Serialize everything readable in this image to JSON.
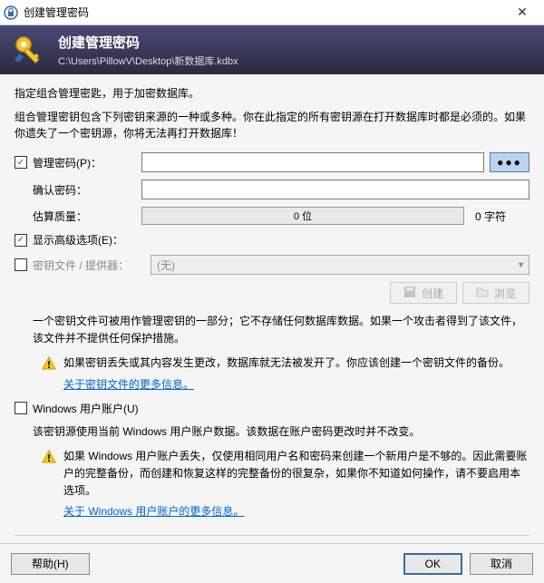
{
  "titlebar": {
    "title": "创建管理密码"
  },
  "header": {
    "title": "创建管理密码",
    "path": "C:\\Users\\PillowV\\Desktop\\新数据库.kdbx"
  },
  "intro": {
    "line1": "指定组合管理密匙，用于加密数据库。",
    "line2": "组合管理密钥包含下列密钥来源的一种或多种。你在此指定的所有密钥源在打开数据库时都是必须的。如果你遗失了一个密钥源，你将无法再打开数据库！"
  },
  "password": {
    "label": "管理密码(P)：",
    "confirm_label": "确认密码：",
    "quality_label": "估算质量：",
    "quality_value": "0 位",
    "char_count": "0 字符",
    "dots": "●●●"
  },
  "advanced": {
    "label": "显示高级选项(E)："
  },
  "keyfile": {
    "label": "密钥文件 / 提供器：",
    "combo_value": "(无)",
    "create_btn": "创建",
    "browse_btn": "浏览",
    "desc": "一个密钥文件可被用作管理密钥的一部分；它不存储任何数据库数据。如果一个攻击者得到了该文件，该文件并不提供任何保护措施。",
    "warn": "如果密钥丢失或其内容发生更改，数据库就无法被发开了。你应该创建一个密钥文件的备份。",
    "link": "关于密钥文件的更多信息。"
  },
  "winuser": {
    "label": "Windows 用户账户(U)",
    "desc": "该密钥源使用当前 Windows 用户账户数据。该数据在账户密码更改时并不改变。",
    "warn": "如果 Windows 用户账户丢失，仅使用相同用户名和密码来创建一个新用户是不够的。因此需要账户的完整备份，而创建和恢复这样的完整备份的很复杂，如果你不知道如何操作，请不要启用本选项。",
    "link": "关于 Windows 用户账户的更多信息。"
  },
  "footer": {
    "help": "帮助(H)",
    "ok": "OK",
    "cancel": "取消"
  }
}
